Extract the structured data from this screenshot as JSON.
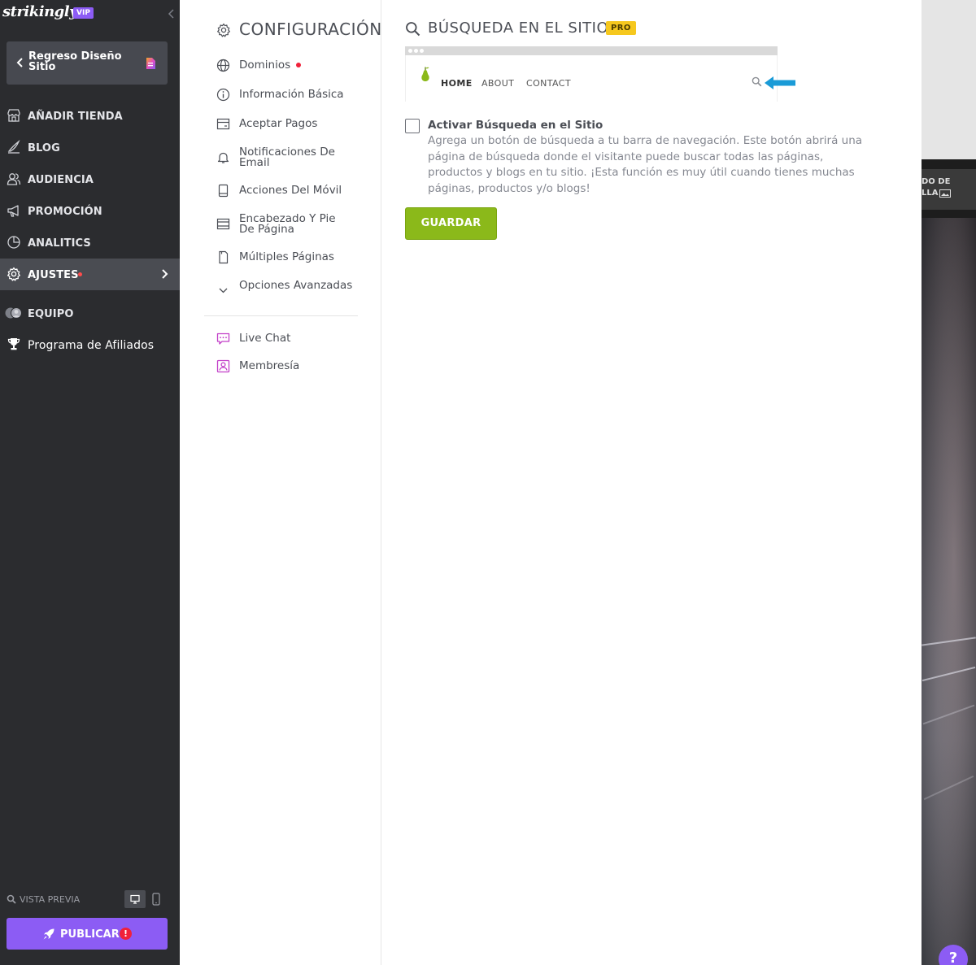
{
  "sidebar": {
    "logo": "strikingly",
    "vip_badge": "VIP",
    "back_button": "Regreso Diseño Sitio",
    "items": [
      {
        "label": "AÑADIR TIENDA",
        "icon": "store-icon"
      },
      {
        "label": "BLOG",
        "icon": "pen-icon"
      },
      {
        "label": "AUDIENCIA",
        "icon": "people-icon"
      },
      {
        "label": "PROMOCIÓN",
        "icon": "megaphone-icon"
      },
      {
        "label": "ANALITICS",
        "icon": "pie-chart-icon"
      },
      {
        "label": "AJUSTES",
        "icon": "gear-icon",
        "active": true
      },
      {
        "label": "EQUIPO",
        "icon": "team-avatars-icon"
      },
      {
        "label": "Programa de Afiliados",
        "icon": "trophy-icon"
      }
    ],
    "preview_label": "VISTA PREVIA",
    "publish_label": "PUBLICAR",
    "publish_alert": "!"
  },
  "settings_menu": {
    "title": "CONFIGURACIÓN",
    "items": [
      {
        "label": "Dominios",
        "icon": "globe-icon",
        "has_dot": true
      },
      {
        "label": "Información Básica",
        "icon": "info-icon"
      },
      {
        "label": "Aceptar Pagos",
        "icon": "credit-card-icon"
      },
      {
        "label": "Notificaciones De Email",
        "icon": "bell-icon"
      },
      {
        "label": "Acciones Del Móvil",
        "icon": "mobile-icon"
      },
      {
        "label": "Encabezado Y Pie De Página",
        "icon": "layout-icon"
      },
      {
        "label": "Múltiples Páginas",
        "icon": "pages-icon"
      },
      {
        "label": "Opciones Avanzadas",
        "icon": "chevron-down-icon"
      }
    ],
    "extras": [
      {
        "label": "Live Chat",
        "icon": "chat-icon"
      },
      {
        "label": "Membresía",
        "icon": "member-icon"
      }
    ]
  },
  "main": {
    "title": "BÚSQUEDA EN EL SITIO",
    "pro_badge": "PRO",
    "mock_nav": [
      "HOME",
      "ABOUT",
      "CONTACT"
    ],
    "checkbox_label": "Activar Búsqueda en el Sitio",
    "checkbox_checked": false,
    "description": "Agrega un botón de búsqueda a tu barra de navegación. Este botón abrirá una página de búsqueda donde el visitante puede buscar todas las páginas, productos y blogs en tu sitio. ¡Esta función es muy útil cuando tienes muchas páginas, productos y/o blogs!",
    "save_label": "GUARDAR"
  },
  "preview": {
    "button_line1": "DO DE",
    "button_line2": "LLA",
    "help_label": "?"
  },
  "colors": {
    "sidebar_bg": "#2b2c2f",
    "accent_purple": "#8c5cf4",
    "save_green": "#8bb91a",
    "pro_yellow": "#f6c81e",
    "alert_red": "#f0213a",
    "arrow_blue": "#1a9bd7"
  }
}
